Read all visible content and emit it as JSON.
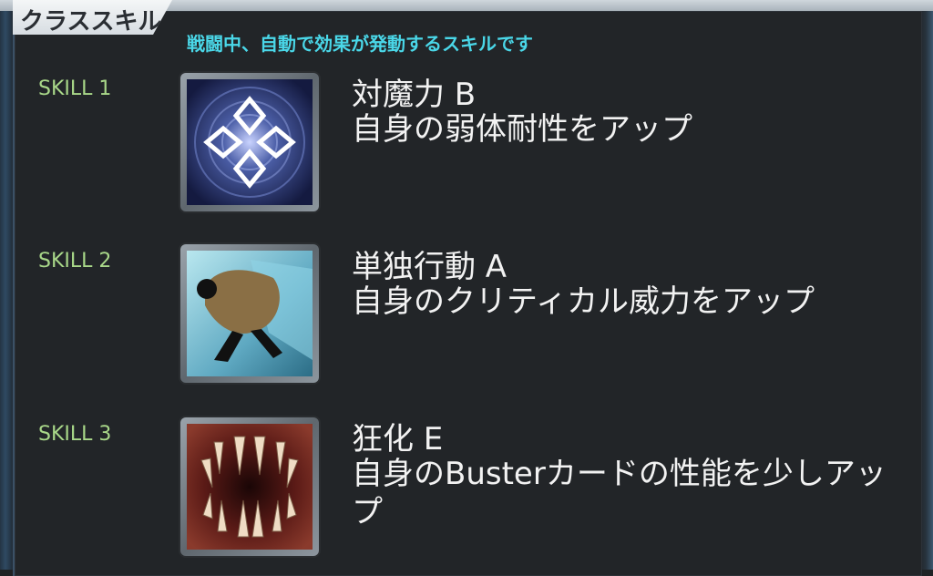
{
  "header": {
    "title": "クラススキル",
    "subtitle": "戦闘中、自動で効果が発動するスキルです"
  },
  "skills": [
    {
      "label": "SKILL 1",
      "name": "対魔力 B",
      "description": "自身の弱体耐性をアップ",
      "icon": "magic-resistance-icon"
    },
    {
      "label": "SKILL 2",
      "name": "単独行動 A",
      "description": "自身のクリティカル威力をアップ",
      "icon": "independent-action-icon"
    },
    {
      "label": "SKILL 3",
      "name": "狂化 E",
      "description": "自身のBusterカードの性能を少しアップ",
      "icon": "madness-enhancement-icon"
    }
  ],
  "colors": {
    "subtitle": "#4ad7e8",
    "skill_label": "#a9d889",
    "panel_bg": "#222528"
  }
}
